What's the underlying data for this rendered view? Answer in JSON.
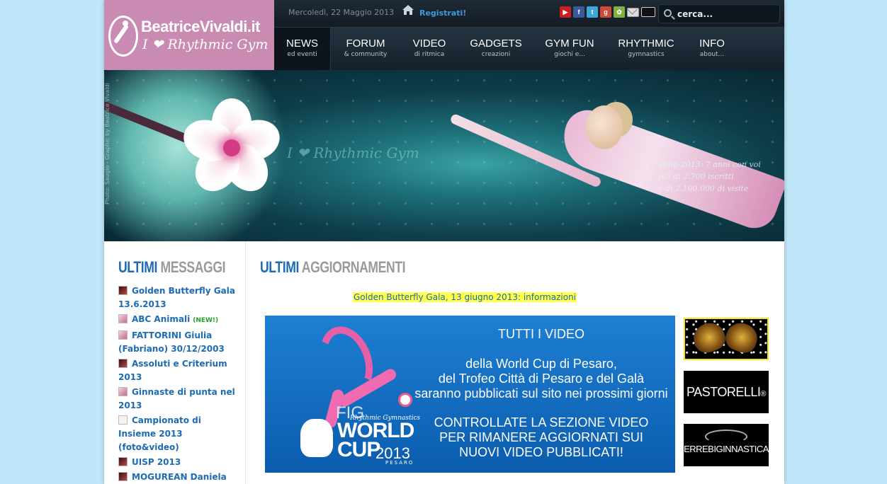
{
  "site": {
    "logo_title": "BeatriceVivaldi.it",
    "logo_subtitle": "I ❤ Rhythmic Gym"
  },
  "topbar": {
    "date": "Mercoledì, 22 Maggio 2013",
    "register_label": "Registrati!",
    "social": [
      {
        "name": "youtube-icon",
        "glyph": "▶",
        "color": "#cc1f1f"
      },
      {
        "name": "facebook-icon",
        "glyph": "f",
        "color": "#3b5998"
      },
      {
        "name": "twitter-icon",
        "glyph": "t",
        "color": "#3fa7d8"
      },
      {
        "name": "google-icon",
        "glyph": "g",
        "color": "#d14836"
      },
      {
        "name": "myspace-icon",
        "glyph": "✿",
        "color": "#7cb342"
      }
    ],
    "search_placeholder": "cerca..."
  },
  "nav": [
    {
      "main": "NEWS",
      "sub": "ed eventi",
      "width": 80
    },
    {
      "main": "FORUM",
      "sub": "& community",
      "width": 98
    },
    {
      "main": "VIDEO",
      "sub": "di ritmica",
      "width": 82
    },
    {
      "main": "GADGETS",
      "sub": "creazioni",
      "width": 106
    },
    {
      "main": "GYM FUN",
      "sub": "giochi e...",
      "width": 102
    },
    {
      "main": "RHYTHMIC",
      "sub": "gymnastics",
      "width": 114
    },
    {
      "main": "INFO",
      "sub": "about...",
      "width": 72
    }
  ],
  "banner": {
    "tagline": "I ❤ Rhythmic Gym",
    "credit": "Photo: Saugio - Graphic by Beatrice Vivaldi",
    "stats": [
      "2006-2013: 7 anni con voi",
      "più di 2.700 iscritti",
      "e di 2.100.000 di visite"
    ]
  },
  "sidebar": {
    "title_a": "ULTIMI",
    "title_b": "MESSAGGI",
    "messages": [
      {
        "label": "Golden Butterfly Gala 13.6.2013",
        "thumb": "dark",
        "badge": ""
      },
      {
        "label": "ABC Animali",
        "thumb": "light",
        "badge": "(NEW!)"
      },
      {
        "label": "FATTORINI Giulia (Fabriano) 30/12/2003",
        "thumb": "light",
        "badge": ""
      },
      {
        "label": "Assoluti e Criterium 2013",
        "thumb": "dark",
        "badge": ""
      },
      {
        "label": "Ginnaste di punta nel 2013",
        "thumb": "light",
        "badge": ""
      },
      {
        "label": "Campionato di Insieme 2013 (foto&video)",
        "thumb": "blank",
        "badge": ""
      },
      {
        "label": "UISP 2013",
        "thumb": "dark",
        "badge": ""
      },
      {
        "label": "MOGUREAN Daniela",
        "thumb": "dark",
        "badge": ""
      }
    ]
  },
  "main": {
    "title_a": "ULTIMI",
    "title_b": "AGGIORNAMENTI",
    "notice_link": "Golden Butterfly Gala, 13 giugno 2013: informazioni",
    "promo": {
      "logo_fig": "FIG",
      "logo_rg": "Rhythmic Gymnastics",
      "logo_world": "WORLD",
      "logo_cup": "CUP",
      "logo_year": "2013",
      "logo_city": "PESARO",
      "line1": "TUTTI I VIDEO",
      "line2": "della World Cup di Pesaro,\ndel Trofeo Città di Pesaro e del Galà\nsaranno pubblicati sul sito nei prossimi giorni",
      "line3": "CONTROLLATE LA SEZIONE VIDEO\nPER RIMANERE AGGIORNATI SUI\nNUOVI VIDEO PUBBLICATI!"
    },
    "sponsors": {
      "pastorelli": "PASTORELLI",
      "pastorelli_reg": "®",
      "errebi": "ERREBIGINNASTICA"
    }
  }
}
